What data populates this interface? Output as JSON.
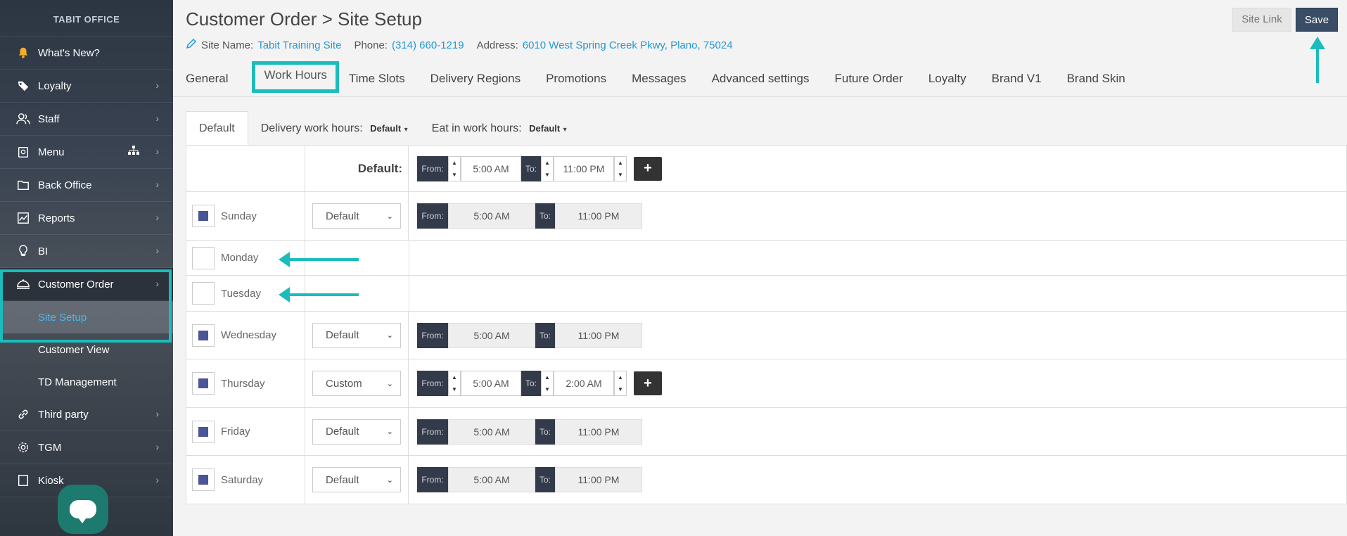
{
  "sidebar": {
    "brand": "TABIT OFFICE",
    "items": [
      {
        "label": "What's New?",
        "icon": "bell-icon"
      },
      {
        "label": "Loyalty",
        "icon": "tag-icon"
      },
      {
        "label": "Staff",
        "icon": "users-icon"
      },
      {
        "label": "Menu",
        "icon": "menu-book-icon"
      },
      {
        "label": "Back Office",
        "icon": "folder-icon"
      },
      {
        "label": "Reports",
        "icon": "chart-icon"
      },
      {
        "label": "BI",
        "icon": "bulb-icon"
      },
      {
        "label": "Customer Order",
        "icon": "dish-icon"
      }
    ],
    "sub_items": [
      "Site Setup",
      "Customer View",
      "TD Management"
    ],
    "items_after": [
      {
        "label": "Third party",
        "icon": "link-icon"
      },
      {
        "label": "TGM",
        "icon": "gear-icon"
      },
      {
        "label": "Kiosk",
        "icon": "kiosk-icon"
      }
    ]
  },
  "header": {
    "title": "Customer Order > Site Setup",
    "site_name_label": "Site Name:",
    "site_name": "Tabit Training Site",
    "phone_label": "Phone:",
    "phone": "(314) 660-1219",
    "address_label": "Address:",
    "address": "6010 West Spring Creek Pkwy, Plano, 75024",
    "site_link": "Site Link",
    "save": "Save"
  },
  "tabs": [
    "General",
    "Work Hours",
    "Time Slots",
    "Delivery Regions",
    "Promotions",
    "Messages",
    "Advanced settings",
    "Future Order",
    "Loyalty",
    "Brand V1",
    "Brand Skin"
  ],
  "subtabs": {
    "default": "Default",
    "delivery_label": "Delivery work hours:",
    "delivery_value": "Default",
    "eatin_label": "Eat in work hours:",
    "eatin_value": "Default"
  },
  "hours": {
    "default_label": "Default:",
    "from_label": "From:",
    "to_label": "To:",
    "default_from": "5:00 AM",
    "default_to": "11:00 PM",
    "days": [
      {
        "name": "Sunday",
        "checked": true,
        "mode": "Default",
        "from": "5:00 AM",
        "to": "11:00 PM"
      },
      {
        "name": "Monday",
        "checked": false
      },
      {
        "name": "Tuesday",
        "checked": false
      },
      {
        "name": "Wednesday",
        "checked": true,
        "mode": "Default",
        "from": "5:00 AM",
        "to": "11:00 PM"
      },
      {
        "name": "Thursday",
        "checked": true,
        "mode": "Custom",
        "from": "5:00 AM",
        "to": "2:00 AM"
      },
      {
        "name": "Friday",
        "checked": true,
        "mode": "Default",
        "from": "5:00 AM",
        "to": "11:00 PM"
      },
      {
        "name": "Saturday",
        "checked": true,
        "mode": "Default",
        "from": "5:00 AM",
        "to": "11:00 PM"
      }
    ]
  },
  "colors": {
    "accent": "#1bbcbc",
    "link": "#2598d6",
    "save": "#3a4d66",
    "checkbox": "#4a5597"
  }
}
